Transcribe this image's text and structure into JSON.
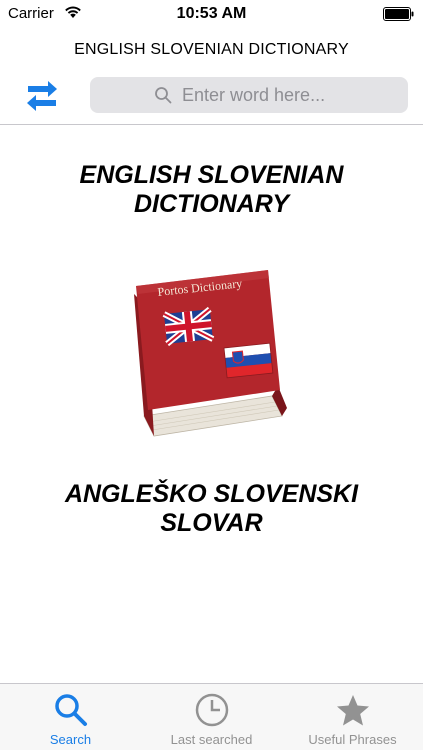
{
  "status_bar": {
    "carrier": "Carrier",
    "time": "10:53 AM"
  },
  "nav": {
    "title": "ENGLISH SLOVENIAN DICTIONARY"
  },
  "search": {
    "placeholder": "Enter word here..."
  },
  "main": {
    "heading_english_line1": "ENGLISH SLOVENIAN",
    "heading_english_line2": "DICTIONARY",
    "book_cover_title": "Portos Dictionary",
    "heading_slovenian_line1": "ANGLEŠKO SLOVENSKI",
    "heading_slovenian_line2": "SLOVAR"
  },
  "tabs": [
    {
      "label": "Search",
      "icon": "search-icon",
      "active": true
    },
    {
      "label": "Last searched",
      "icon": "clock-icon",
      "active": false
    },
    {
      "label": "Useful Phrases",
      "icon": "star-icon",
      "active": false
    }
  ],
  "colors": {
    "accent": "#1a7ee6",
    "book_red": "#b3262c",
    "inactive": "#929292"
  }
}
